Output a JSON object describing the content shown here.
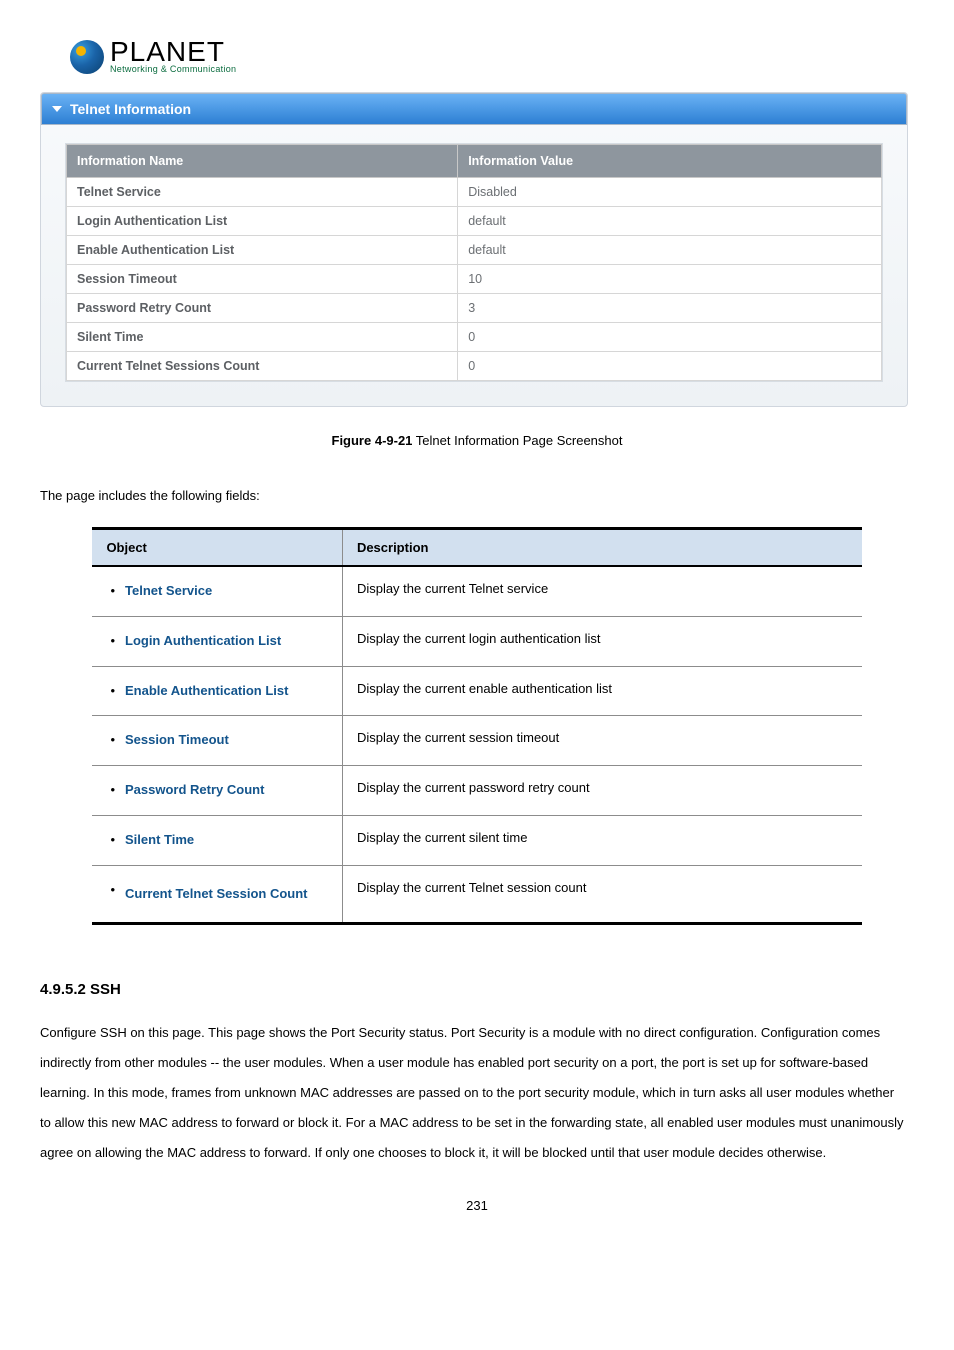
{
  "logo": {
    "word": "PLANET",
    "tagline": "Networking & Communication"
  },
  "panel": {
    "title": "Telnet Information",
    "header_name": "Information Name",
    "header_value": "Information Value",
    "rows": [
      {
        "name": "Telnet Service",
        "value": "Disabled"
      },
      {
        "name": "Login Authentication List",
        "value": "default"
      },
      {
        "name": "Enable Authentication List",
        "value": "default"
      },
      {
        "name": "Session Timeout",
        "value": "10"
      },
      {
        "name": "Password Retry Count",
        "value": "3"
      },
      {
        "name": "Silent Time",
        "value": "0"
      },
      {
        "name": "Current Telnet Sessions Count",
        "value": "0"
      }
    ]
  },
  "figure": {
    "bold": "Figure 4-9-21",
    "text": " Telnet Information Page Screenshot"
  },
  "intro": "The page includes the following fields:",
  "desc_table": {
    "header_obj": "Object",
    "header_desc": "Description",
    "rows": [
      {
        "obj": "Telnet Service",
        "desc": "Display the current Telnet service"
      },
      {
        "obj": "Login Authentication List",
        "desc": "Display the current login authentication list"
      },
      {
        "obj": "Enable Authentication List",
        "desc": "Display the current enable authentication list"
      },
      {
        "obj": "Session Timeout",
        "desc": "Display the current session timeout"
      },
      {
        "obj": "Password Retry Count",
        "desc": "Display the current password retry count"
      },
      {
        "obj": "Silent Time",
        "desc": "Display the current silent time"
      },
      {
        "obj": "Current Telnet Session Count",
        "desc": "Display the current Telnet session count"
      }
    ]
  },
  "section": {
    "heading": "4.9.5.2 SSH",
    "paragraph": "Configure SSH on this page. This page shows the Port Security status. Port Security is a module with no direct configuration. Configuration comes indirectly from other modules -- the user modules. When a user module has enabled port security on a port, the port is set up for software-based learning. In this mode, frames from unknown MAC addresses are passed on to the port security module, which in turn asks all user modules whether to allow this new MAC address to forward or block it. For a MAC address to be set in the forwarding state, all enabled user modules must unanimously agree on allowing the MAC address to forward. If only one chooses to block it, it will be blocked until that user module decides otherwise."
  },
  "page_number": "231"
}
